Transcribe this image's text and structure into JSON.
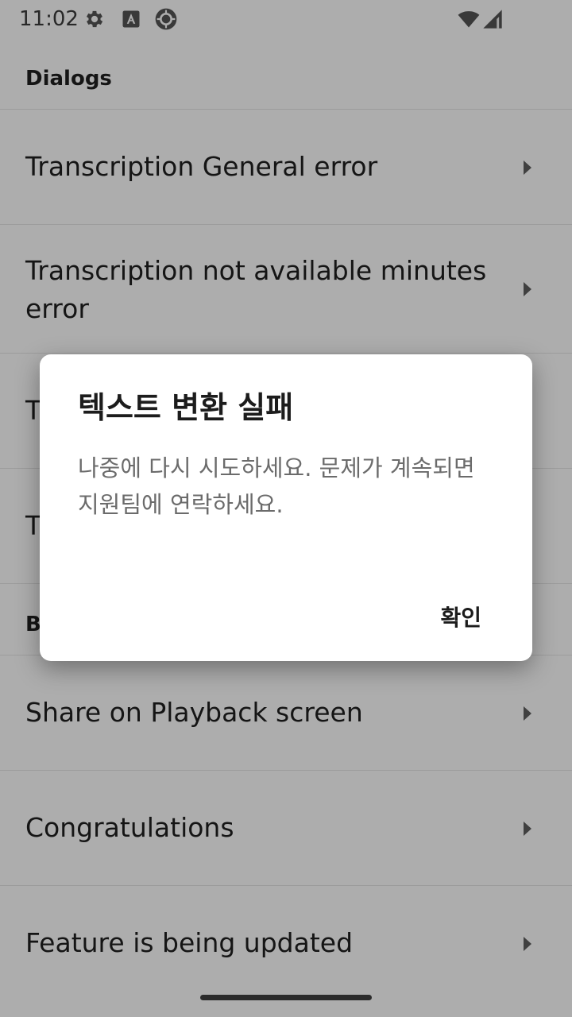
{
  "status_bar": {
    "time": "11:02",
    "icons": [
      "gear-icon",
      "font-a-icon",
      "sync-camera-icon",
      "wifi-icon",
      "signal-icon"
    ]
  },
  "list": {
    "sections": [
      {
        "header": "Dialogs",
        "items": [
          "Transcription General error",
          "Transcription not available minutes error",
          "T",
          "T"
        ]
      },
      {
        "header": "B",
        "items": [
          "Share on Playback screen",
          "Congratulations",
          "Feature is being updated"
        ]
      }
    ]
  },
  "dialog": {
    "title": "텍스트 변환 실패",
    "message": "나중에 다시 시도하세요. 문제가 계속되면 지원팀에 연락하세요.",
    "confirm_label": "확인"
  },
  "colors": {
    "scrim": "#000000",
    "text_primary": "#1f1f1f",
    "text_secondary": "#6b6b6b",
    "divider": "#e6e6e6",
    "chevron": "#5f5f5f"
  }
}
